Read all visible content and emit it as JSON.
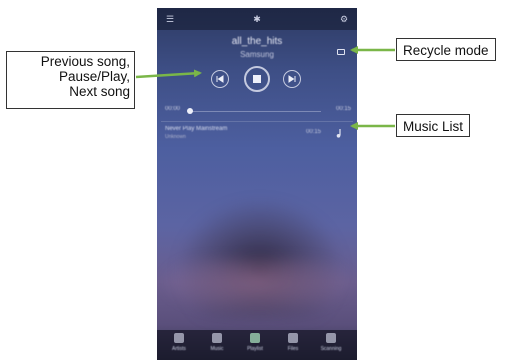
{
  "phone": {
    "song": {
      "title": "all_the_hits",
      "artist": "Samsung"
    },
    "track": {
      "name": "Never Play Mainstream",
      "sub": "Unknown",
      "duration": "00:15"
    },
    "progress": {
      "elapsed": "00:00",
      "total": "00:15"
    },
    "tabs": [
      {
        "label": "Artists",
        "icon": "person-icon"
      },
      {
        "label": "Music",
        "icon": "music-icon"
      },
      {
        "label": "Playlist",
        "icon": "playlist-icon"
      },
      {
        "label": "Files",
        "icon": "folder-icon"
      },
      {
        "label": "Scanning",
        "icon": "scan-icon"
      }
    ],
    "active_tab": "Playlist"
  },
  "callouts": {
    "left_lines": [
      "Previous song,",
      "Pause/Play,",
      "Next song"
    ],
    "recycle": "Recycle mode",
    "music_list": "Music List"
  },
  "colors": {
    "arrow": "#7ab648",
    "callout_border": "#333333"
  }
}
